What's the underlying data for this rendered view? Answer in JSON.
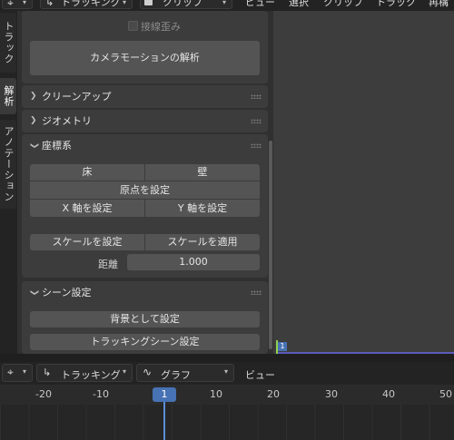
{
  "header": {
    "editor_type": "",
    "mode": "トラッキング",
    "view_mode": "クリップ",
    "menus": [
      "ビュー",
      "選択",
      "クリップ",
      "トラック",
      "再構"
    ]
  },
  "side_tabs": [
    "トラック",
    "解析",
    "アノテーション"
  ],
  "active_tab": "解析",
  "panels": {
    "solve": {
      "tangent_distortion_label": "接線歪み",
      "camera_motion_button": "カメラモーションの解析"
    },
    "cleanup": {
      "title": "クリーンアップ",
      "collapsed": true
    },
    "geometry": {
      "title": "ジオメトリ",
      "collapsed": true
    },
    "orientation": {
      "title": "座標系",
      "floor_button": "床",
      "wall_button": "壁",
      "set_origin_button": "原点を設定",
      "set_x_axis_button": "X 軸を設定",
      "set_y_axis_button": "Y 軸を設定",
      "set_scale_button": "スケールを設定",
      "apply_scale_button": "スケールを適用",
      "distance_label": "距離",
      "distance_value": "1.000"
    },
    "scene_setup": {
      "title": "シーン設定",
      "set_background_button": "背景として設定",
      "setup_tracking_scene_button": "トラッキングシーン設定"
    }
  },
  "viewport": {
    "frame_marker": "1"
  },
  "timeline_header": {
    "mode": "トラッキング",
    "view": "グラフ",
    "menu_view": "ビュー"
  },
  "ruler": {
    "ticks": [
      "-20",
      "-10",
      "10",
      "20",
      "30",
      "40",
      "50"
    ],
    "current_frame": "1"
  },
  "colors": {
    "accent": "#4772b3",
    "playhead": "#5a8fd6",
    "track_bar": "#5b5bb8",
    "frame_marker_green": "#8fd14f"
  }
}
